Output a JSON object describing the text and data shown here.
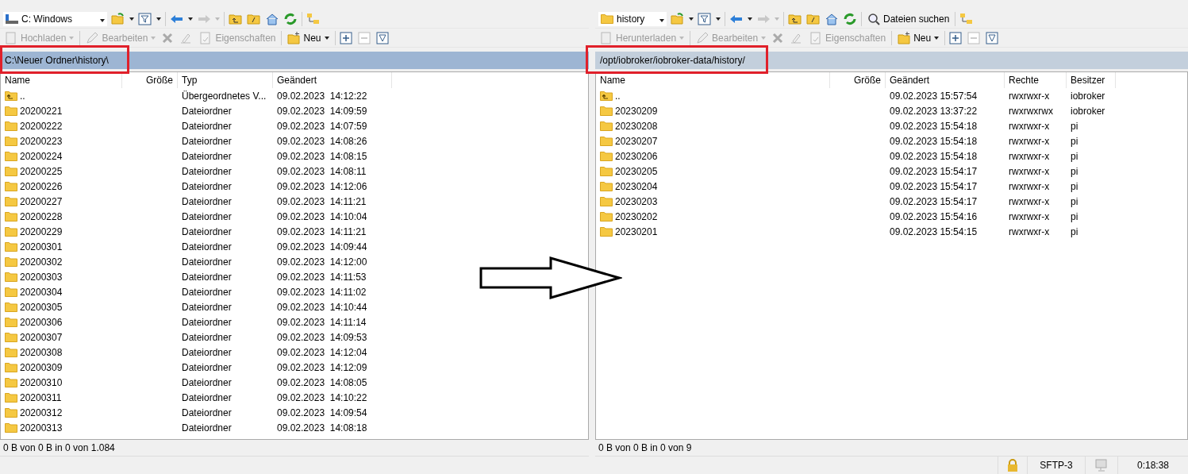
{
  "left_panel": {
    "drive": "C: Windows",
    "toolbar": [
      {
        "label": "Hochladen",
        "disabled": true
      },
      {
        "label": "Bearbeiten",
        "disabled": true
      },
      {
        "label": "Eigenschaften",
        "disabled": true
      },
      {
        "label": "Neu",
        "disabled": false
      }
    ],
    "path": "C:\\Neuer Ordner\\history\\",
    "columns": [
      "Name",
      "Größe",
      "Typ",
      "Geändert"
    ],
    "rows": [
      {
        "kind": "parent",
        "name": "..",
        "type": "Übergeordnetes V...",
        "modified": "09.02.2023  14:12:22"
      },
      {
        "kind": "folder",
        "name": "20200221",
        "type": "Dateiordner",
        "modified": "09.02.2023  14:09:59"
      },
      {
        "kind": "folder",
        "name": "20200222",
        "type": "Dateiordner",
        "modified": "09.02.2023  14:07:59"
      },
      {
        "kind": "folder",
        "name": "20200223",
        "type": "Dateiordner",
        "modified": "09.02.2023  14:08:26"
      },
      {
        "kind": "folder",
        "name": "20200224",
        "type": "Dateiordner",
        "modified": "09.02.2023  14:08:15"
      },
      {
        "kind": "folder",
        "name": "20200225",
        "type": "Dateiordner",
        "modified": "09.02.2023  14:08:11"
      },
      {
        "kind": "folder",
        "name": "20200226",
        "type": "Dateiordner",
        "modified": "09.02.2023  14:12:06"
      },
      {
        "kind": "folder",
        "name": "20200227",
        "type": "Dateiordner",
        "modified": "09.02.2023  14:11:21"
      },
      {
        "kind": "folder",
        "name": "20200228",
        "type": "Dateiordner",
        "modified": "09.02.2023  14:10:04"
      },
      {
        "kind": "folder",
        "name": "20200229",
        "type": "Dateiordner",
        "modified": "09.02.2023  14:11:21"
      },
      {
        "kind": "folder",
        "name": "20200301",
        "type": "Dateiordner",
        "modified": "09.02.2023  14:09:44"
      },
      {
        "kind": "folder",
        "name": "20200302",
        "type": "Dateiordner",
        "modified": "09.02.2023  14:12:00"
      },
      {
        "kind": "folder",
        "name": "20200303",
        "type": "Dateiordner",
        "modified": "09.02.2023  14:11:53"
      },
      {
        "kind": "folder",
        "name": "20200304",
        "type": "Dateiordner",
        "modified": "09.02.2023  14:11:02"
      },
      {
        "kind": "folder",
        "name": "20200305",
        "type": "Dateiordner",
        "modified": "09.02.2023  14:10:44"
      },
      {
        "kind": "folder",
        "name": "20200306",
        "type": "Dateiordner",
        "modified": "09.02.2023  14:11:14"
      },
      {
        "kind": "folder",
        "name": "20200307",
        "type": "Dateiordner",
        "modified": "09.02.2023  14:09:53"
      },
      {
        "kind": "folder",
        "name": "20200308",
        "type": "Dateiordner",
        "modified": "09.02.2023  14:12:04"
      },
      {
        "kind": "folder",
        "name": "20200309",
        "type": "Dateiordner",
        "modified": "09.02.2023  14:12:09"
      },
      {
        "kind": "folder",
        "name": "20200310",
        "type": "Dateiordner",
        "modified": "09.02.2023  14:08:05"
      },
      {
        "kind": "folder",
        "name": "20200311",
        "type": "Dateiordner",
        "modified": "09.02.2023  14:10:22"
      },
      {
        "kind": "folder",
        "name": "20200312",
        "type": "Dateiordner",
        "modified": "09.02.2023  14:09:54"
      },
      {
        "kind": "folder",
        "name": "20200313",
        "type": "Dateiordner",
        "modified": "09.02.2023  14:08:18"
      }
    ],
    "status": "0 B von 0 B in 0 von 1.084"
  },
  "right_panel": {
    "drive": "history",
    "search_button": "Dateien suchen",
    "toolbar": [
      {
        "label": "Herunterladen",
        "disabled": true
      },
      {
        "label": "Bearbeiten",
        "disabled": true
      },
      {
        "label": "Eigenschaften",
        "disabled": true
      },
      {
        "label": "Neu",
        "disabled": false
      }
    ],
    "path": "/opt/iobroker/iobroker-data/history/",
    "columns": [
      "Name",
      "Größe",
      "Geändert",
      "Rechte",
      "Besitzer"
    ],
    "rows": [
      {
        "kind": "parent",
        "name": "..",
        "modified": "09.02.2023 15:57:54",
        "rights": "rwxrwxr-x",
        "owner": "iobroker"
      },
      {
        "kind": "folder",
        "name": "20230209",
        "modified": "09.02.2023 13:37:22",
        "rights": "rwxrwxrwx",
        "owner": "iobroker"
      },
      {
        "kind": "folder",
        "name": "20230208",
        "modified": "09.02.2023 15:54:18",
        "rights": "rwxrwxr-x",
        "owner": "pi"
      },
      {
        "kind": "folder",
        "name": "20230207",
        "modified": "09.02.2023 15:54:18",
        "rights": "rwxrwxr-x",
        "owner": "pi"
      },
      {
        "kind": "folder",
        "name": "20230206",
        "modified": "09.02.2023 15:54:18",
        "rights": "rwxrwxr-x",
        "owner": "pi"
      },
      {
        "kind": "folder",
        "name": "20230205",
        "modified": "09.02.2023 15:54:17",
        "rights": "rwxrwxr-x",
        "owner": "pi"
      },
      {
        "kind": "folder",
        "name": "20230204",
        "modified": "09.02.2023 15:54:17",
        "rights": "rwxrwxr-x",
        "owner": "pi"
      },
      {
        "kind": "folder",
        "name": "20230203",
        "modified": "09.02.2023 15:54:17",
        "rights": "rwxrwxr-x",
        "owner": "pi"
      },
      {
        "kind": "folder",
        "name": "20230202",
        "modified": "09.02.2023 15:54:16",
        "rights": "rwxrwxr-x",
        "owner": "pi"
      },
      {
        "kind": "folder",
        "name": "20230201",
        "modified": "09.02.2023 15:54:15",
        "rights": "rwxrwxr-x",
        "owner": "pi"
      }
    ],
    "status": "0 B von 0 B in 0 von 9"
  },
  "status_bar": {
    "protocol": "SFTP-3",
    "elapsed": "0:18:38"
  }
}
